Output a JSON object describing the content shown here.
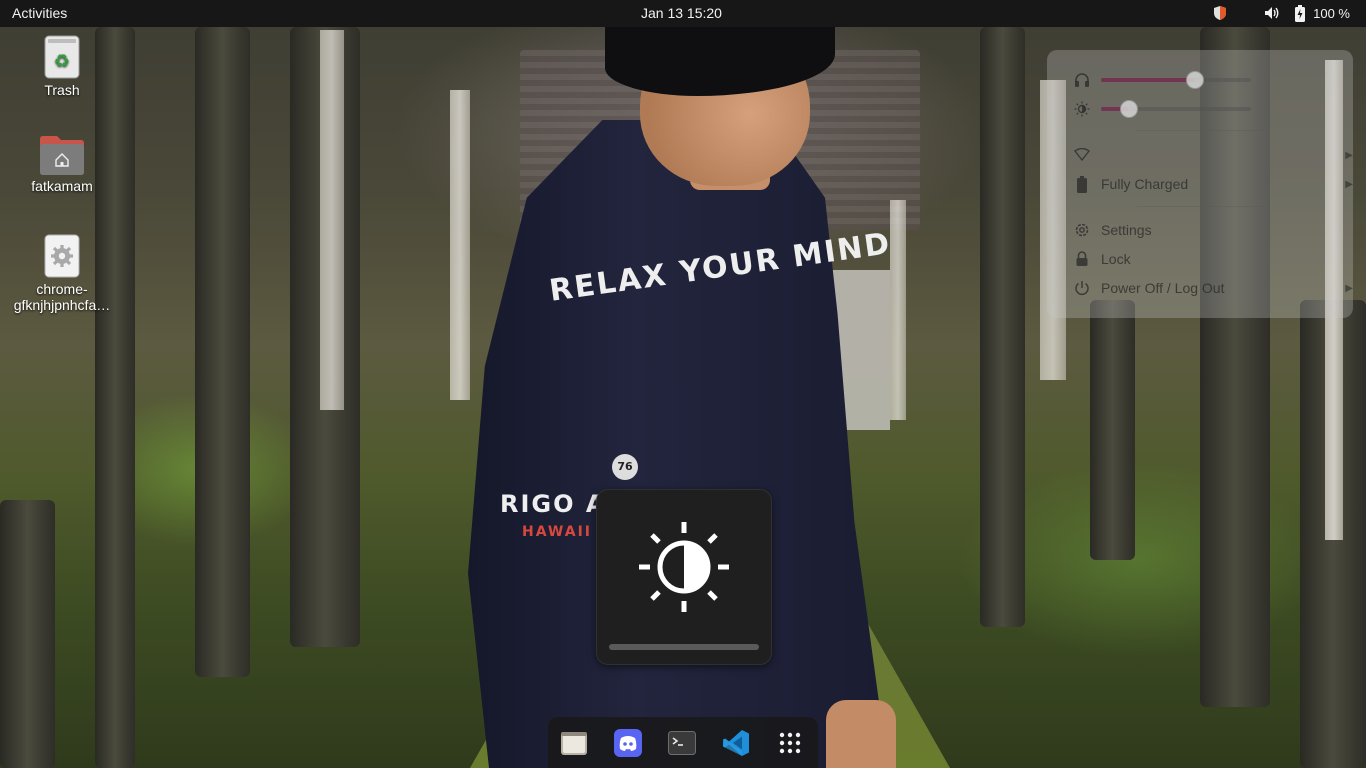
{
  "topbar": {
    "activities": "Activities",
    "clock": "Jan 13  15:20",
    "battery_percent": "100 %",
    "icons": [
      "shield-icon",
      "volume-icon",
      "battery-icon"
    ]
  },
  "desktop": {
    "items": [
      {
        "label": "Trash",
        "icon": "trash-icon"
      },
      {
        "label": "fatkamam",
        "icon": "home-folder-icon"
      },
      {
        "label": "chrome-\ngfknjhjpnhcfa…",
        "label_line1": "chrome-",
        "label_line2": "gfknjhjpnhcfa…",
        "icon": "gear-icon"
      }
    ]
  },
  "system_menu": {
    "volume_level": 0.62,
    "brightness_level": 0.18,
    "battery_label": "Fully Charged",
    "settings_label": "Settings",
    "lock_label": "Lock",
    "power_label": "Power Off / Log Out",
    "icons": [
      "headphones-icon",
      "brightness-icon",
      "wifi-icon",
      "battery-icon",
      "settings-icon",
      "lock-icon",
      "power-icon"
    ]
  },
  "osd": {
    "icon": "brightness-icon",
    "level": 0.0
  },
  "dock": {
    "apps": [
      "files-icon",
      "discord-icon",
      "terminal-icon",
      "vscode-icon",
      "app-grid-icon"
    ]
  },
  "wallpaper": {
    "print_line1": "RELAX YOUR MIND",
    "print_line2": "RIGO APP",
    "print_line3": "HAWAII",
    "print_badge": "76"
  },
  "colors": {
    "topbar": "#171717",
    "osd_bg": "#1f1f1f",
    "slider_fill": "#782850",
    "vscode_blue": "#1e8fd8",
    "discord_blue": "#5865f2"
  }
}
